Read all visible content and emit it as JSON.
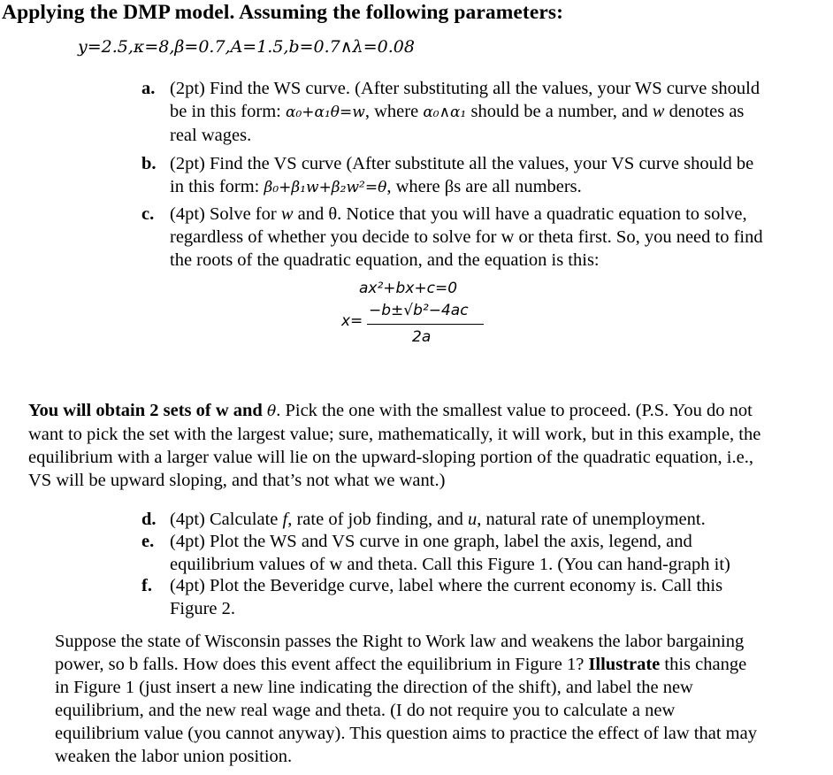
{
  "title": "Applying the DMP model. Assuming the following parameters:",
  "parameters": "y=2.5,κ=8,β=0.7,A=1.5,b=0.7∧λ=0.08",
  "items": [
    {
      "marker": "a.",
      "lines": [
        "(2pt) Find the WS curve. (After substituting all the values, your WS curve should",
        "be in this form: ",
        "real wages."
      ],
      "form_eq": "α₀+α₁θ=w",
      "form_after": ", where ",
      "form_cond": "α₀∧α₁",
      "form_tail": " should be a number, and ",
      "form_var": "w",
      "form_end": " denotes as"
    },
    {
      "marker": "b.",
      "lines": [
        "(2pt) Find the VS curve (After substitute all the values, your VS curve should be",
        "in this form: "
      ],
      "form_eq": "β₀+β₁w+β₂w²=θ",
      "form_tail": ", where βs are all numbers."
    },
    {
      "marker": "c.",
      "line1_a": "(4pt) Solve for ",
      "line1_var": "w",
      "line1_b": " and θ. Notice that you will have a quadratic equation to solve,",
      "lines": [
        "regardless of whether you decide to solve for w or theta first. So, you need to find",
        "the roots of the quadratic equation, and the equation is this:"
      ]
    }
  ],
  "quadratic": {
    "equation": "ax²+bx+c=0",
    "lhs": "x=",
    "numerator": "−b±√b²−4ac",
    "denominator": "2a"
  },
  "note": {
    "bold": "You will obtain 2 sets of w and ",
    "theta": "θ",
    "rest_line1": ". Pick the one with the smallest value to proceed. (P.S. You do not",
    "lines": [
      "want to pick the set with the largest value; sure, mathematically, it will work, but in this example, the",
      "equilibrium with a larger value will lie on the upward-sloping portion of the quadratic equation, i.e.,",
      "VS will be upward sloping, and that’s not what we want.)"
    ]
  },
  "items2": [
    {
      "marker": "d.",
      "a": "(4pt) Calculate ",
      "var1": "f",
      "b": ", rate of job finding, and ",
      "var2": "u",
      "c": ", natural rate of unemployment."
    },
    {
      "marker": "e.",
      "lines": [
        "(4pt) Plot the WS and VS curve in one graph, label the axis, legend, and",
        "equilibrium values of w and theta. Call this Figure 1. (You can hand-graph it)"
      ]
    },
    {
      "marker": "f.",
      "lines": [
        "(4pt) Plot the Beveridge curve, label where the current economy is. Call this",
        "Figure 2."
      ]
    }
  ],
  "final": {
    "line1": "Suppose the state of Wisconsin passes the Right to Work law and weakens the labor bargaining",
    "line2_a": "power, so b falls. How does this event affect the equilibrium in Figure 1? ",
    "line2_bold": "Illustrate",
    "line2_b": " this change",
    "lines": [
      "in Figure 1 (just insert a new line indicating the direction of the shift), and label the new",
      "equilibrium, and the new real wage and theta. (I do not require you to calculate a new",
      "equilibrium value (you cannot anyway). This question aims to practice the effect of law that may",
      "weaken the labor union position."
    ]
  }
}
